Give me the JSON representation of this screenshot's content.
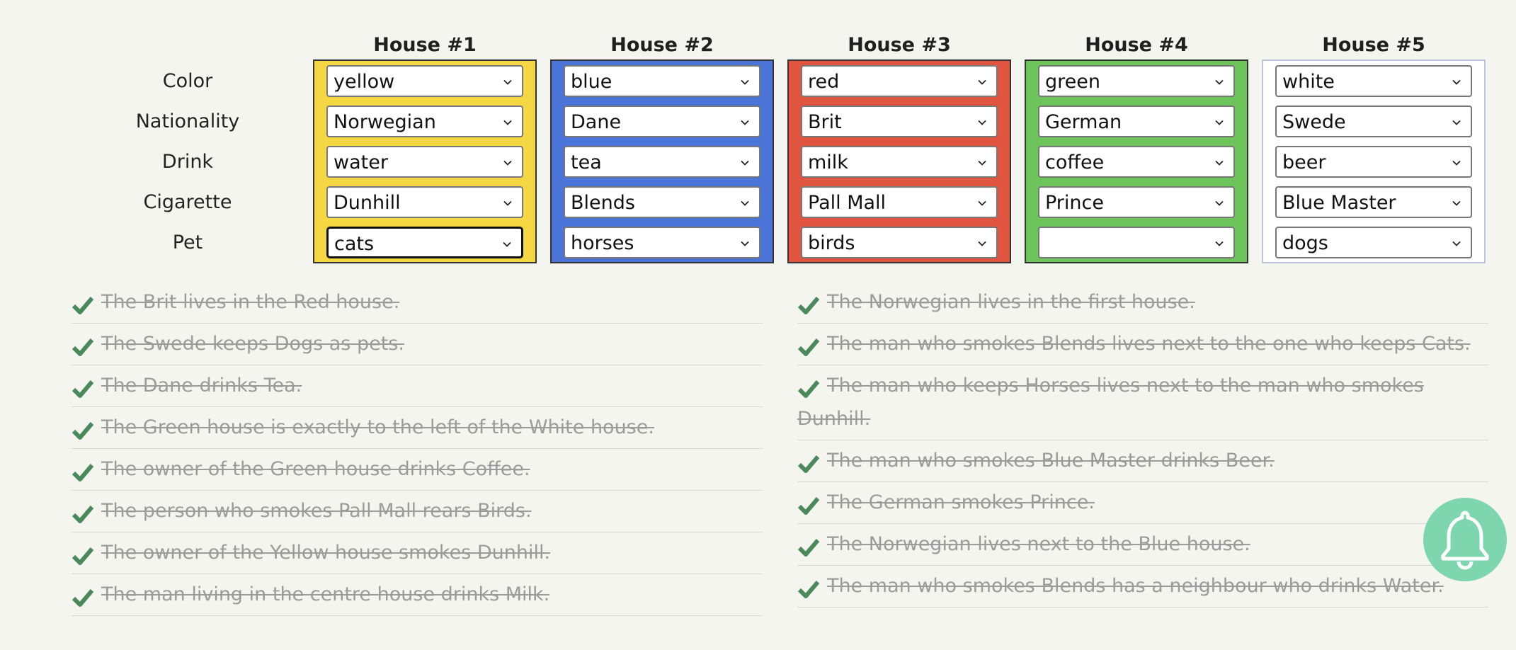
{
  "colors": {
    "background": "#f5f5f0",
    "yellow": "#f5d743",
    "blue": "#4a74d8",
    "red": "#e05440",
    "green": "#6cc45a",
    "white": "#ffffff",
    "check": "#4a8a5a",
    "bell_bg": "#7dd6ad"
  },
  "row_labels": [
    "Color",
    "Nationality",
    "Drink",
    "Cigarette",
    "Pet"
  ],
  "houses": [
    {
      "title": "House #1",
      "color": "#f5d743",
      "values": [
        "yellow",
        "Norwegian",
        "water",
        "Dunhill",
        "cats"
      ]
    },
    {
      "title": "House #2",
      "color": "#4a74d8",
      "values": [
        "blue",
        "Dane",
        "tea",
        "Blends",
        "horses"
      ]
    },
    {
      "title": "House #3",
      "color": "#e05440",
      "values": [
        "red",
        "Brit",
        "milk",
        "Pall Mall",
        "birds"
      ]
    },
    {
      "title": "House #4",
      "color": "#6cc45a",
      "values": [
        "green",
        "German",
        "coffee",
        "Prince",
        ""
      ]
    },
    {
      "title": "House #5",
      "color": "#ffffff",
      "values": [
        "white",
        "Swede",
        "beer",
        "Blue Master",
        "dogs"
      ]
    }
  ],
  "clues_left": [
    "The Brit lives in the Red house.",
    "The Swede keeps Dogs as pets.",
    "The Dane drinks Tea.",
    "The Green house is exactly to the left of the White house.",
    "The owner of the Green house drinks Coffee.",
    "The person who smokes Pall Mall rears Birds.",
    "The owner of the Yellow house smokes Dunhill.",
    "The man living in the centre house drinks Milk."
  ],
  "clues_right": [
    "The Norwegian lives in the first house.",
    "The man who smokes Blends lives next to the one who keeps Cats.",
    "The man who keeps Horses lives next to the man who smokes Dunhill.",
    "The man who smokes Blue Master drinks Beer.",
    "The German smokes Prince.",
    "The Norwegian lives next to the Blue house.",
    "The man who smokes Blends has a neighbour who drinks Water."
  ],
  "icons": {
    "check": "check-icon",
    "bell": "bell-icon",
    "dropdown": "chevron-down-icon"
  }
}
